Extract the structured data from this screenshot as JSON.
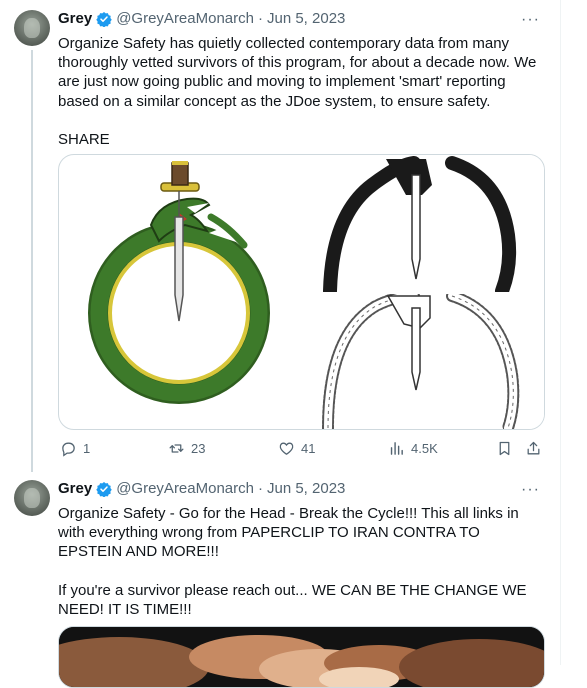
{
  "tweets": [
    {
      "author": {
        "name": "Grey",
        "handle": "@GreyAreaMonarch"
      },
      "date": "Jun 5, 2023",
      "dot": "·",
      "more": "···",
      "text": "Organize Safety has quietly collected contemporary data from many thoroughly vetted survivors of this program, for about a decade now. We are just now going public and moving to implement 'smart' reporting based on a similar concept as the JDoe system, to ensure safety.\n\nSHARE",
      "counts": {
        "replies": "1",
        "reposts": "23",
        "likes": "41",
        "views": "4.5K"
      }
    },
    {
      "author": {
        "name": "Grey",
        "handle": "@GreyAreaMonarch"
      },
      "date": "Jun 5, 2023",
      "dot": "·",
      "more": "···",
      "text": "Organize Safety - Go for the Head - Break the Cycle!!! This all links in with everything wrong from PAPERCLIP TO IRAN CONTRA TO EPSTEIN AND MORE!!!\n\nIf you're a survivor please reach out... WE CAN BE THE CHANGE WE NEED! IT IS TIME!!!"
    }
  ],
  "colors": {
    "accent": "#1d9bf0",
    "muted": "#536471",
    "border": "#cfd9de",
    "snake_green": "#3d7a2a",
    "snake_yellow": "#d7c63a"
  },
  "icons": [
    "verified-badge-icon",
    "more-icon",
    "reply-icon",
    "repost-icon",
    "like-icon",
    "views-icon",
    "bookmark-icon",
    "share-icon"
  ]
}
